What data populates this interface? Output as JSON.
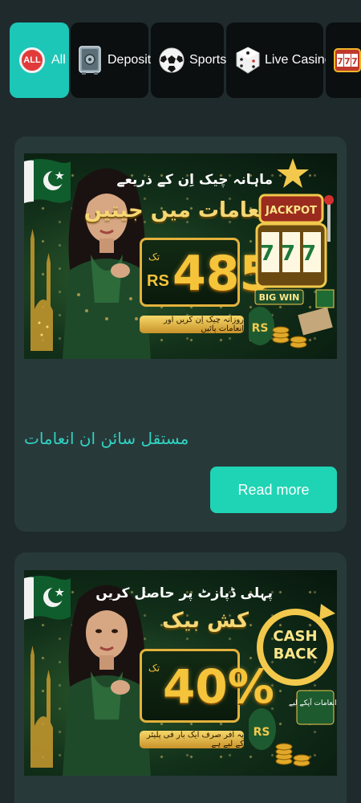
{
  "tabs": [
    {
      "label": "All",
      "icon": "all-badge-icon",
      "badge_text": "ALL",
      "active": true
    },
    {
      "label": "Deposit",
      "icon": "safe-icon",
      "active": false
    },
    {
      "label": "Sports",
      "icon": "soccer-ball-icon",
      "active": false
    },
    {
      "label": "Live Casino",
      "icon": "dice-icon",
      "active": false
    },
    {
      "label": "",
      "icon": "slot-machine-icon",
      "active": false
    }
  ],
  "promos": [
    {
      "banner": {
        "line1": "ماہانہ چیک اِن کے ذریعے",
        "line2": "انعامات میں جیتیں",
        "amount_prefix": "RS",
        "amount": "485",
        "amount_suffix": "تک",
        "strip_text": "روزانہ چیک اِن کریں اور انعامات پائیں",
        "jackpot": "JACKPOT",
        "reels": "777",
        "big_win": "BIG WIN",
        "bag_text": "RS"
      },
      "title": "مستقل سائن ان انعامات",
      "button": "Read more"
    },
    {
      "banner": {
        "line1": "پہلی ڈپازٹ پر حاصل کریں",
        "line2": "کش بیک",
        "amount": "40%",
        "amount_suffix": "تک",
        "strip_text": "یہ آفر صرف ایک بار فی پلیئر کے لیے ہے",
        "cashback_top": "CASH",
        "cashback_bottom": "BACK",
        "wallet_text": "انعامات آپکے لیے !",
        "bag_text": "RS"
      }
    }
  ],
  "colors": {
    "background": "#1f2a2c",
    "card": "#28393a",
    "accent": "#1ed4b4",
    "active_tab": "#1cc7b8",
    "gold": "#f5c43a"
  }
}
